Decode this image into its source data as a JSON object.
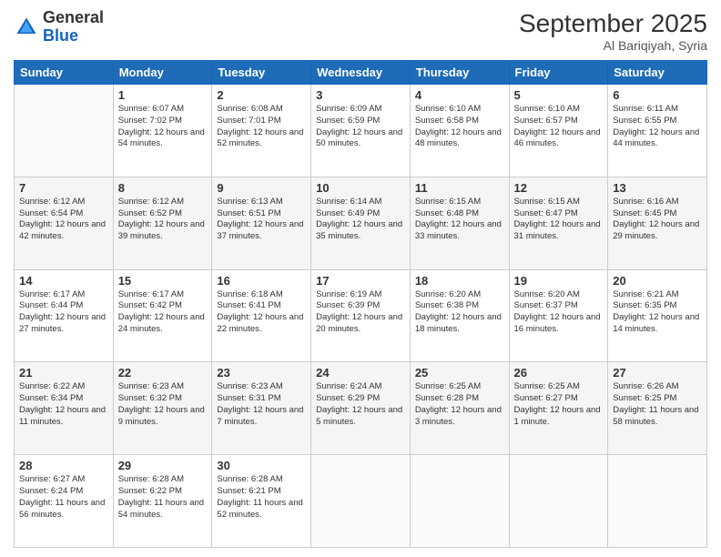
{
  "header": {
    "logo_general": "General",
    "logo_blue": "Blue",
    "month_year": "September 2025",
    "location": "Al Bariqiyah, Syria"
  },
  "days_of_week": [
    "Sunday",
    "Monday",
    "Tuesday",
    "Wednesday",
    "Thursday",
    "Friday",
    "Saturday"
  ],
  "weeks": [
    [
      {
        "day": "",
        "info": ""
      },
      {
        "day": "1",
        "info": "Sunrise: 6:07 AM\nSunset: 7:02 PM\nDaylight: 12 hours\nand 54 minutes."
      },
      {
        "day": "2",
        "info": "Sunrise: 6:08 AM\nSunset: 7:01 PM\nDaylight: 12 hours\nand 52 minutes."
      },
      {
        "day": "3",
        "info": "Sunrise: 6:09 AM\nSunset: 6:59 PM\nDaylight: 12 hours\nand 50 minutes."
      },
      {
        "day": "4",
        "info": "Sunrise: 6:10 AM\nSunset: 6:58 PM\nDaylight: 12 hours\nand 48 minutes."
      },
      {
        "day": "5",
        "info": "Sunrise: 6:10 AM\nSunset: 6:57 PM\nDaylight: 12 hours\nand 46 minutes."
      },
      {
        "day": "6",
        "info": "Sunrise: 6:11 AM\nSunset: 6:55 PM\nDaylight: 12 hours\nand 44 minutes."
      }
    ],
    [
      {
        "day": "7",
        "info": "Sunrise: 6:12 AM\nSunset: 6:54 PM\nDaylight: 12 hours\nand 42 minutes."
      },
      {
        "day": "8",
        "info": "Sunrise: 6:12 AM\nSunset: 6:52 PM\nDaylight: 12 hours\nand 39 minutes."
      },
      {
        "day": "9",
        "info": "Sunrise: 6:13 AM\nSunset: 6:51 PM\nDaylight: 12 hours\nand 37 minutes."
      },
      {
        "day": "10",
        "info": "Sunrise: 6:14 AM\nSunset: 6:49 PM\nDaylight: 12 hours\nand 35 minutes."
      },
      {
        "day": "11",
        "info": "Sunrise: 6:15 AM\nSunset: 6:48 PM\nDaylight: 12 hours\nand 33 minutes."
      },
      {
        "day": "12",
        "info": "Sunrise: 6:15 AM\nSunset: 6:47 PM\nDaylight: 12 hours\nand 31 minutes."
      },
      {
        "day": "13",
        "info": "Sunrise: 6:16 AM\nSunset: 6:45 PM\nDaylight: 12 hours\nand 29 minutes."
      }
    ],
    [
      {
        "day": "14",
        "info": "Sunrise: 6:17 AM\nSunset: 6:44 PM\nDaylight: 12 hours\nand 27 minutes."
      },
      {
        "day": "15",
        "info": "Sunrise: 6:17 AM\nSunset: 6:42 PM\nDaylight: 12 hours\nand 24 minutes."
      },
      {
        "day": "16",
        "info": "Sunrise: 6:18 AM\nSunset: 6:41 PM\nDaylight: 12 hours\nand 22 minutes."
      },
      {
        "day": "17",
        "info": "Sunrise: 6:19 AM\nSunset: 6:39 PM\nDaylight: 12 hours\nand 20 minutes."
      },
      {
        "day": "18",
        "info": "Sunrise: 6:20 AM\nSunset: 6:38 PM\nDaylight: 12 hours\nand 18 minutes."
      },
      {
        "day": "19",
        "info": "Sunrise: 6:20 AM\nSunset: 6:37 PM\nDaylight: 12 hours\nand 16 minutes."
      },
      {
        "day": "20",
        "info": "Sunrise: 6:21 AM\nSunset: 6:35 PM\nDaylight: 12 hours\nand 14 minutes."
      }
    ],
    [
      {
        "day": "21",
        "info": "Sunrise: 6:22 AM\nSunset: 6:34 PM\nDaylight: 12 hours\nand 11 minutes."
      },
      {
        "day": "22",
        "info": "Sunrise: 6:23 AM\nSunset: 6:32 PM\nDaylight: 12 hours\nand 9 minutes."
      },
      {
        "day": "23",
        "info": "Sunrise: 6:23 AM\nSunset: 6:31 PM\nDaylight: 12 hours\nand 7 minutes."
      },
      {
        "day": "24",
        "info": "Sunrise: 6:24 AM\nSunset: 6:29 PM\nDaylight: 12 hours\nand 5 minutes."
      },
      {
        "day": "25",
        "info": "Sunrise: 6:25 AM\nSunset: 6:28 PM\nDaylight: 12 hours\nand 3 minutes."
      },
      {
        "day": "26",
        "info": "Sunrise: 6:25 AM\nSunset: 6:27 PM\nDaylight: 12 hours\nand 1 minute."
      },
      {
        "day": "27",
        "info": "Sunrise: 6:26 AM\nSunset: 6:25 PM\nDaylight: 11 hours\nand 58 minutes."
      }
    ],
    [
      {
        "day": "28",
        "info": "Sunrise: 6:27 AM\nSunset: 6:24 PM\nDaylight: 11 hours\nand 56 minutes."
      },
      {
        "day": "29",
        "info": "Sunrise: 6:28 AM\nSunset: 6:22 PM\nDaylight: 11 hours\nand 54 minutes."
      },
      {
        "day": "30",
        "info": "Sunrise: 6:28 AM\nSunset: 6:21 PM\nDaylight: 11 hours\nand 52 minutes."
      },
      {
        "day": "",
        "info": ""
      },
      {
        "day": "",
        "info": ""
      },
      {
        "day": "",
        "info": ""
      },
      {
        "day": "",
        "info": ""
      }
    ]
  ]
}
